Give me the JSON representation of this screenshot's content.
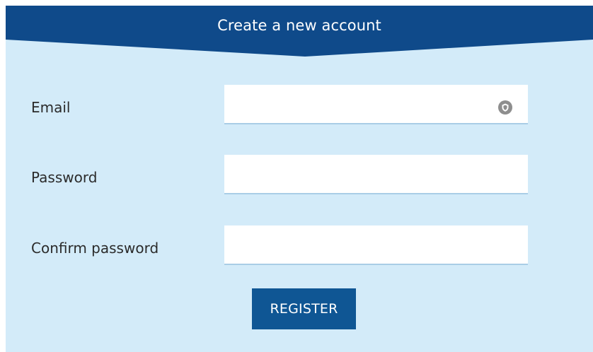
{
  "header": {
    "title": "Create a new account",
    "color": "#0f4a8a"
  },
  "form": {
    "email": {
      "label": "Email",
      "value": "",
      "has_autofill_icon": true
    },
    "password": {
      "label": "Password",
      "value": ""
    },
    "confirm_password": {
      "label": "Confirm password",
      "value": ""
    },
    "register_button": "REGISTER"
  },
  "icons": {
    "autofill": "password-manager-icon"
  },
  "colors": {
    "panel_background": "#d3ebf9",
    "button": "#0f5694",
    "input_underline": "#a9cde6"
  }
}
